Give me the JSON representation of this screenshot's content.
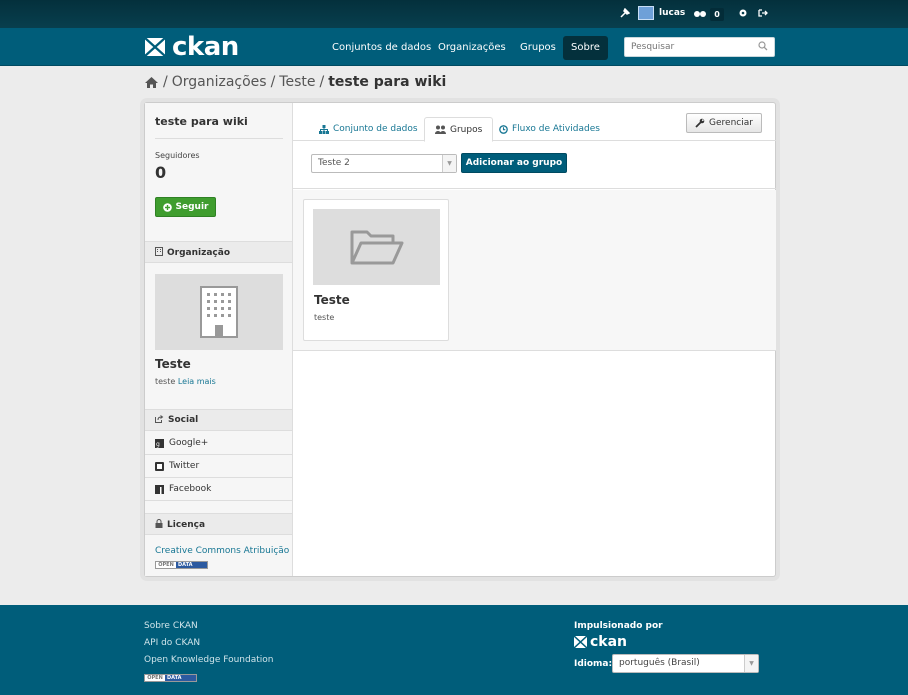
{
  "account": {
    "username": "lucas",
    "dashboard_count": "0"
  },
  "masthead": {
    "logo_text": "ckan",
    "nav": [
      "Conjuntos de dados",
      "Organizações",
      "Grupos",
      "Sobre"
    ],
    "active_nav": "Sobre",
    "search_placeholder": "Pesquisar"
  },
  "breadcrumb": {
    "items": [
      "Organizações",
      "Teste"
    ],
    "current": "teste para wiki"
  },
  "sidebar": {
    "title": "teste para wiki",
    "followers_label": "Seguidores",
    "followers_count": "0",
    "follow_button": "Seguir",
    "org_heading": "Organização",
    "org_name": "Teste",
    "org_desc": "teste",
    "read_more": "Leia mais",
    "social_heading": "Social",
    "social_items": [
      "Google+",
      "Twitter",
      "Facebook"
    ],
    "license_heading": "Licença",
    "license_link": "Creative Commons Atribuição",
    "open_data_badge": {
      "open": "OPEN",
      "data": "DATA"
    }
  },
  "tabs": {
    "datasets": "Conjunto de dados",
    "groups": "Grupos",
    "activity": "Fluxo de Atividades",
    "manage_button": "Gerenciar"
  },
  "group_form": {
    "selected": "Teste 2",
    "add_button": "Adicionar ao grupo"
  },
  "groups": [
    {
      "title": "Teste",
      "description": "teste"
    }
  ],
  "footer": {
    "links": [
      "Sobre CKAN",
      "API do CKAN",
      "Open Knowledge Foundation"
    ],
    "powered_by": "Impulsionado por",
    "logo_text": "ckan",
    "language_label": "Idioma:",
    "language_value": "português (Brasil)",
    "open_data_badge": {
      "open": "OPEN",
      "data": "DATA"
    }
  },
  "colors": {
    "masthead": "#005d7a",
    "account_bar": "#073e4d",
    "follow_green": "#3f9d2e",
    "link": "#187794"
  }
}
